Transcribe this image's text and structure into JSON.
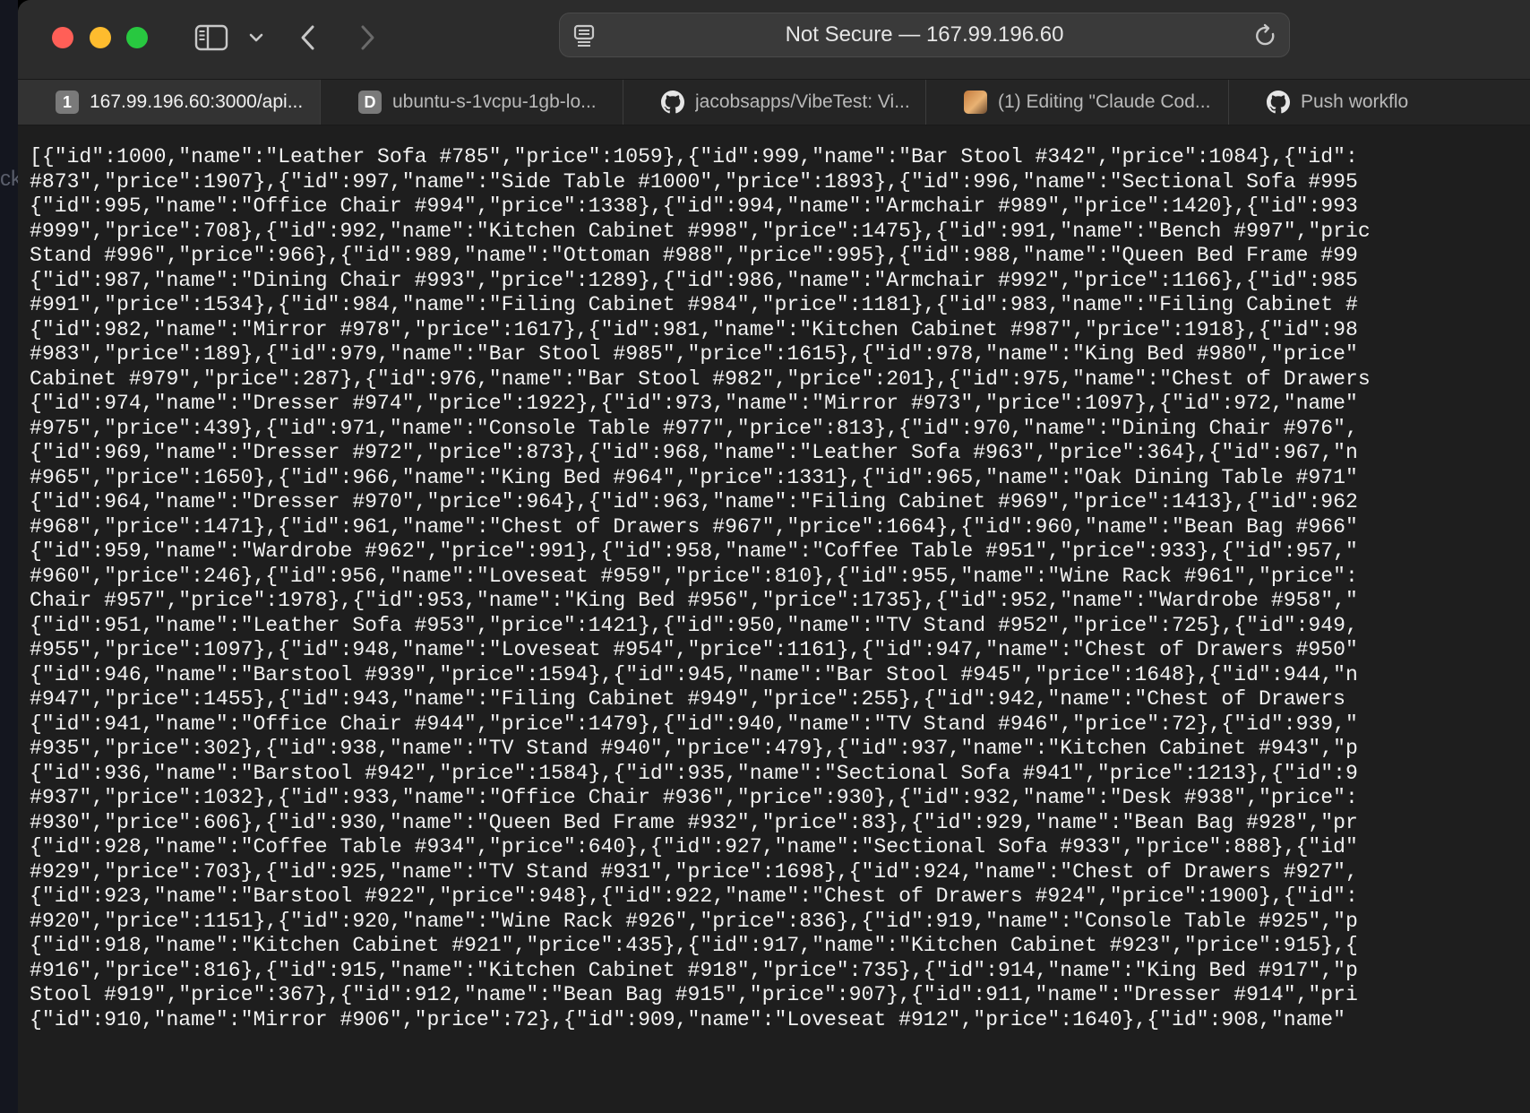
{
  "desktop": {
    "peek_text": "ck"
  },
  "address_bar": {
    "text": "Not Secure — 167.99.196.60"
  },
  "tabs": [
    {
      "favicon": "1",
      "favicon_type": "letter",
      "title": "167.99.196.60:3000/api...",
      "active": true
    },
    {
      "favicon": "D",
      "favicon_type": "letter",
      "title": "ubuntu-s-1vcpu-1gb-lo...",
      "active": false
    },
    {
      "favicon": "github-icon",
      "favicon_type": "github",
      "title": "jacobsapps/VibeTest: Vi...",
      "active": false
    },
    {
      "favicon": "thumbnail-image",
      "favicon_type": "image",
      "title": "(1) Editing \"Claude Cod...",
      "active": false
    },
    {
      "favicon": "github-icon",
      "favicon_type": "github",
      "title": "Push workflo",
      "active": false
    }
  ],
  "colors": {
    "close": "#ff5f57",
    "minimize": "#febc2e",
    "maximize": "#28c840",
    "page_background": "#1e1e1e",
    "text": "#f2f2f2"
  },
  "json_lines": [
    "[{\"id\":1000,\"name\":\"Leather Sofa #785\",\"price\":1059},{\"id\":999,\"name\":\"Bar Stool #342\",\"price\":1084},{\"id\":",
    "#873\",\"price\":1907},{\"id\":997,\"name\":\"Side Table #1000\",\"price\":1893},{\"id\":996,\"name\":\"Sectional Sofa #995",
    "{\"id\":995,\"name\":\"Office Chair #994\",\"price\":1338},{\"id\":994,\"name\":\"Armchair #989\",\"price\":1420},{\"id\":993",
    "#999\",\"price\":708},{\"id\":992,\"name\":\"Kitchen Cabinet #998\",\"price\":1475},{\"id\":991,\"name\":\"Bench #997\",\"pric",
    "Stand #996\",\"price\":966},{\"id\":989,\"name\":\"Ottoman #988\",\"price\":995},{\"id\":988,\"name\":\"Queen Bed Frame #99",
    "{\"id\":987,\"name\":\"Dining Chair #993\",\"price\":1289},{\"id\":986,\"name\":\"Armchair #992\",\"price\":1166},{\"id\":985",
    "#991\",\"price\":1534},{\"id\":984,\"name\":\"Filing Cabinet #984\",\"price\":1181},{\"id\":983,\"name\":\"Filing Cabinet #",
    "{\"id\":982,\"name\":\"Mirror #978\",\"price\":1617},{\"id\":981,\"name\":\"Kitchen Cabinet #987\",\"price\":1918},{\"id\":98",
    "#983\",\"price\":189},{\"id\":979,\"name\":\"Bar Stool #985\",\"price\":1615},{\"id\":978,\"name\":\"King Bed #980\",\"price\"",
    "Cabinet #979\",\"price\":287},{\"id\":976,\"name\":\"Bar Stool #982\",\"price\":201},{\"id\":975,\"name\":\"Chest of Drawers",
    "{\"id\":974,\"name\":\"Dresser #974\",\"price\":1922},{\"id\":973,\"name\":\"Mirror #973\",\"price\":1097},{\"id\":972,\"name\"",
    "#975\",\"price\":439},{\"id\":971,\"name\":\"Console Table #977\",\"price\":813},{\"id\":970,\"name\":\"Dining Chair #976\",",
    "{\"id\":969,\"name\":\"Dresser #972\",\"price\":873},{\"id\":968,\"name\":\"Leather Sofa #963\",\"price\":364},{\"id\":967,\"n",
    "#965\",\"price\":1650},{\"id\":966,\"name\":\"King Bed #964\",\"price\":1331},{\"id\":965,\"name\":\"Oak Dining Table #971\"",
    "{\"id\":964,\"name\":\"Dresser #970\",\"price\":964},{\"id\":963,\"name\":\"Filing Cabinet #969\",\"price\":1413},{\"id\":962",
    "#968\",\"price\":1471},{\"id\":961,\"name\":\"Chest of Drawers #967\",\"price\":1664},{\"id\":960,\"name\":\"Bean Bag #966\"",
    "{\"id\":959,\"name\":\"Wardrobe #962\",\"price\":991},{\"id\":958,\"name\":\"Coffee Table #951\",\"price\":933},{\"id\":957,\"",
    "#960\",\"price\":246},{\"id\":956,\"name\":\"Loveseat #959\",\"price\":810},{\"id\":955,\"name\":\"Wine Rack #961\",\"price\":",
    "Chair #957\",\"price\":1978},{\"id\":953,\"name\":\"King Bed #956\",\"price\":1735},{\"id\":952,\"name\":\"Wardrobe #958\",\"",
    "{\"id\":951,\"name\":\"Leather Sofa #953\",\"price\":1421},{\"id\":950,\"name\":\"TV Stand #952\",\"price\":725},{\"id\":949,",
    "#955\",\"price\":1097},{\"id\":948,\"name\":\"Loveseat #954\",\"price\":1161},{\"id\":947,\"name\":\"Chest of Drawers #950\"",
    "{\"id\":946,\"name\":\"Barstool #939\",\"price\":1594},{\"id\":945,\"name\":\"Bar Stool #945\",\"price\":1648},{\"id\":944,\"n",
    "#947\",\"price\":1455},{\"id\":943,\"name\":\"Filing Cabinet #949\",\"price\":255},{\"id\":942,\"name\":\"Chest of Drawers ",
    "{\"id\":941,\"name\":\"Office Chair #944\",\"price\":1479},{\"id\":940,\"name\":\"TV Stand #946\",\"price\":72},{\"id\":939,\"",
    "#935\",\"price\":302},{\"id\":938,\"name\":\"TV Stand #940\",\"price\":479},{\"id\":937,\"name\":\"Kitchen Cabinet #943\",\"p",
    "{\"id\":936,\"name\":\"Barstool #942\",\"price\":1584},{\"id\":935,\"name\":\"Sectional Sofa #941\",\"price\":1213},{\"id\":9",
    "#937\",\"price\":1032},{\"id\":933,\"name\":\"Office Chair #936\",\"price\":930},{\"id\":932,\"name\":\"Desk #938\",\"price\":",
    "#930\",\"price\":606},{\"id\":930,\"name\":\"Queen Bed Frame #932\",\"price\":83},{\"id\":929,\"name\":\"Bean Bag #928\",\"pr",
    "{\"id\":928,\"name\":\"Coffee Table #934\",\"price\":640},{\"id\":927,\"name\":\"Sectional Sofa #933\",\"price\":888},{\"id\"",
    "#929\",\"price\":703},{\"id\":925,\"name\":\"TV Stand #931\",\"price\":1698},{\"id\":924,\"name\":\"Chest of Drawers #927\",",
    "{\"id\":923,\"name\":\"Barstool #922\",\"price\":948},{\"id\":922,\"name\":\"Chest of Drawers #924\",\"price\":1900},{\"id\":",
    "#920\",\"price\":1151},{\"id\":920,\"name\":\"Wine Rack #926\",\"price\":836},{\"id\":919,\"name\":\"Console Table #925\",\"p",
    "{\"id\":918,\"name\":\"Kitchen Cabinet #921\",\"price\":435},{\"id\":917,\"name\":\"Kitchen Cabinet #923\",\"price\":915},{",
    "#916\",\"price\":816},{\"id\":915,\"name\":\"Kitchen Cabinet #918\",\"price\":735},{\"id\":914,\"name\":\"King Bed #917\",\"p",
    "Stool #919\",\"price\":367},{\"id\":912,\"name\":\"Bean Bag #915\",\"price\":907},{\"id\":911,\"name\":\"Dresser #914\",\"pri",
    "{\"id\":910,\"name\":\"Mirror #906\",\"price\":72},{\"id\":909,\"name\":\"Loveseat #912\",\"price\":1640},{\"id\":908,\"name\""
  ]
}
